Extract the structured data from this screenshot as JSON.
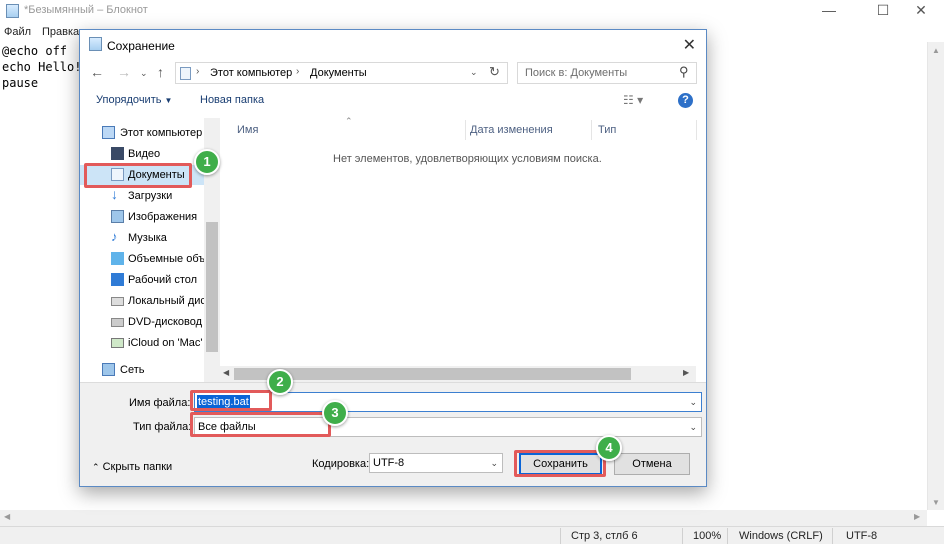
{
  "notepad": {
    "title": "*Безымянный – Блокнот",
    "window_buttons": [
      "—",
      "☐",
      "✕"
    ],
    "menu": [
      "Файл",
      "Правка"
    ],
    "content_lines": [
      "@echo off",
      "echo Hello!",
      "pause"
    ],
    "status": {
      "position": "Стр 3, стлб 6",
      "zoom": "100%",
      "line_ending": "Windows (CRLF)",
      "encoding": "UTF-8"
    }
  },
  "dialog": {
    "title": "Сохранение",
    "breadcrumb": [
      "Этот компьютер",
      "Документы"
    ],
    "search_placeholder": "Поиск в: Документы",
    "toolbar": {
      "organize": "Упорядочить",
      "new_folder": "Новая папка",
      "help": "?"
    },
    "nav_items": [
      {
        "label": "Этот компьютер",
        "icon": "computer-icon"
      },
      {
        "label": "Видео",
        "icon": "video-icon"
      },
      {
        "label": "Документы",
        "icon": "document-icon"
      },
      {
        "label": "Загрузки",
        "icon": "download-icon"
      },
      {
        "label": "Изображения",
        "icon": "image-icon"
      },
      {
        "label": "Музыка",
        "icon": "music-icon"
      },
      {
        "label": "Объемные объ",
        "icon": "cube-icon"
      },
      {
        "label": "Рабочий стол",
        "icon": "desktop-icon"
      },
      {
        "label": "Локальный дис",
        "icon": "drive-icon"
      },
      {
        "label": "DVD-дисковод (",
        "icon": "dvd-icon"
      },
      {
        "label": "iCloud on 'Mac'",
        "icon": "network-drive-icon"
      },
      {
        "label": "Сеть",
        "icon": "network-icon"
      }
    ],
    "columns": [
      "Имя",
      "Дата изменения",
      "Тип"
    ],
    "empty_message": "Нет элементов, удовлетворяющих условиям поиска.",
    "filename_label": "Имя файла:",
    "filename_value": "testing.bat",
    "filetype_label": "Тип файла:",
    "filetype_value": "Все файлы",
    "hide_folders": "Скрыть папки",
    "encoding_label": "Кодировка:",
    "encoding_value": "UTF-8",
    "save_button": "Сохранить",
    "cancel_button": "Отмена"
  },
  "callouts": [
    "1",
    "2",
    "3",
    "4"
  ],
  "colors": {
    "highlight": "#e25a5a",
    "badge": "#3fae4a",
    "accent": "#0a64d6"
  }
}
